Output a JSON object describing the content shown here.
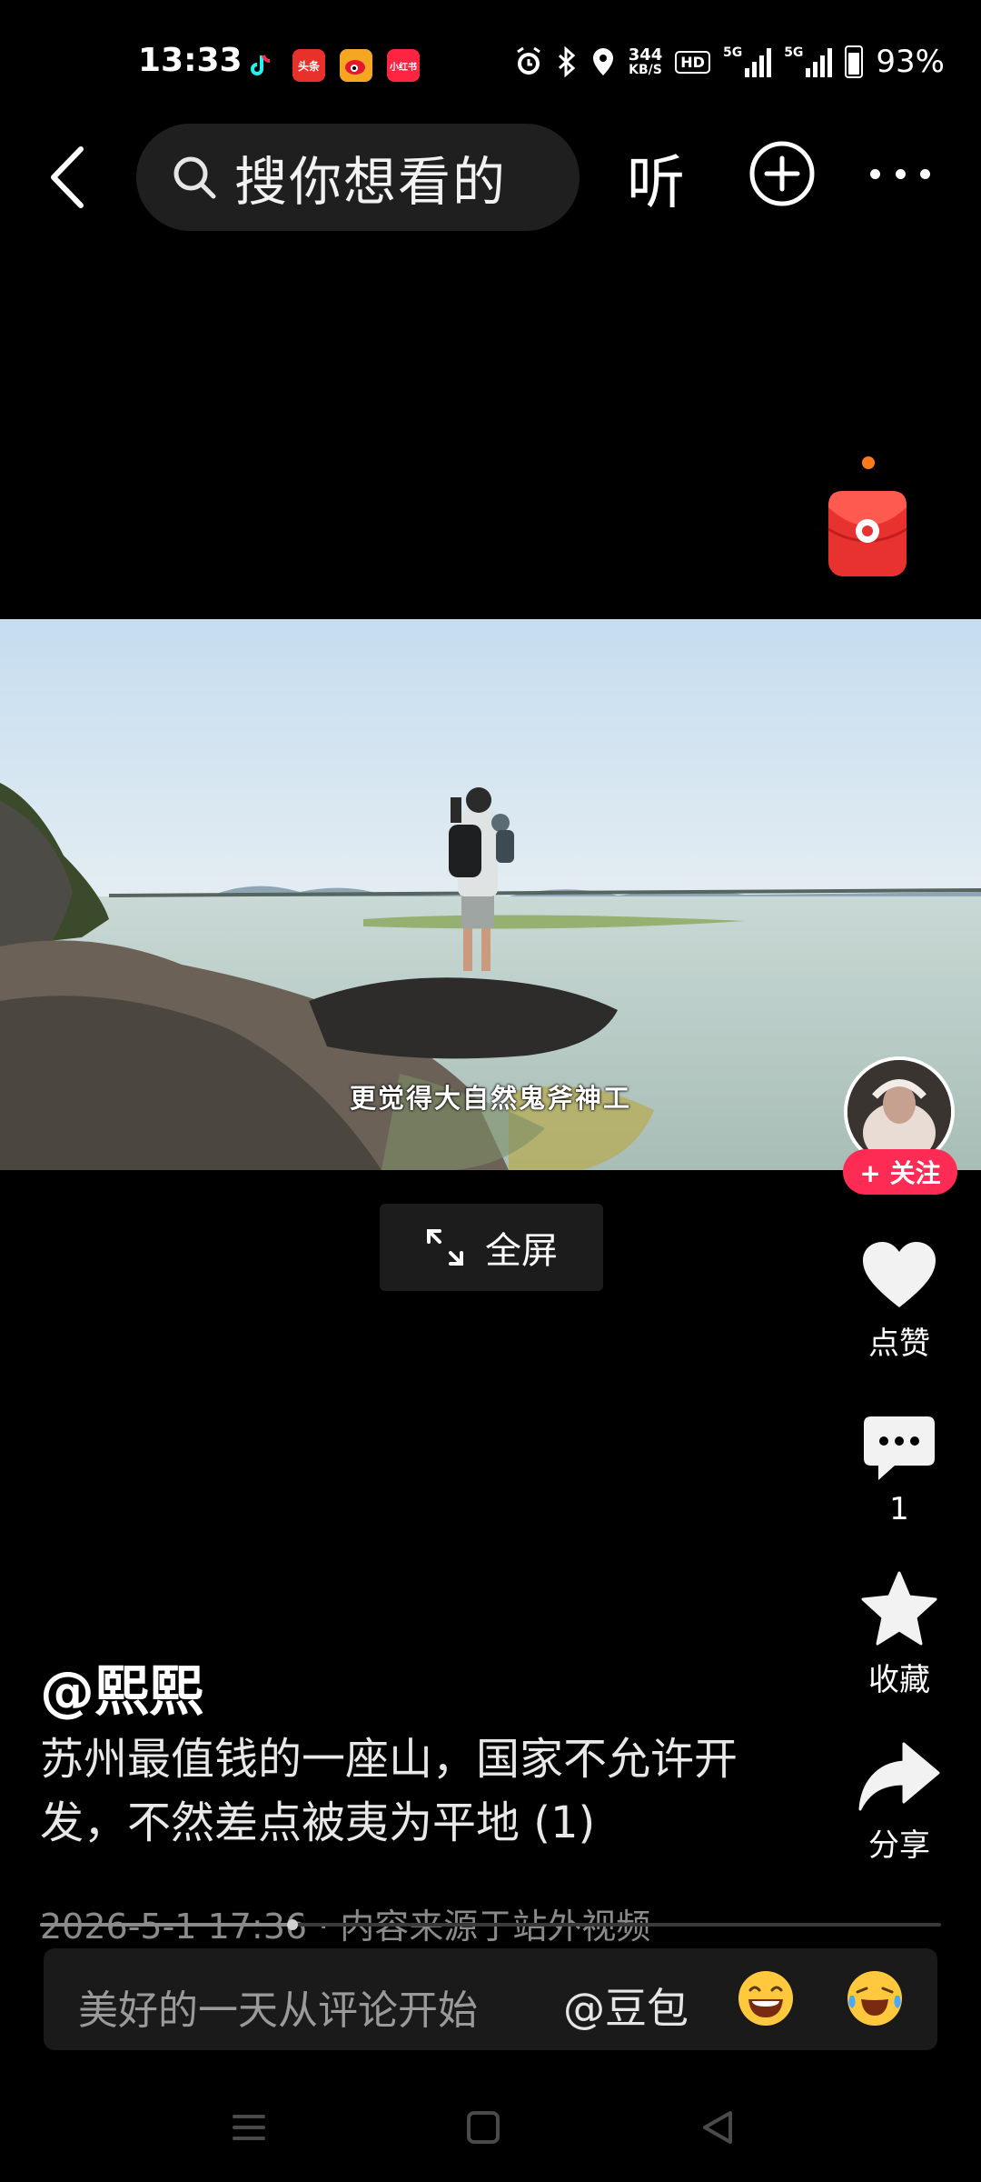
{
  "status_bar": {
    "time": "13:33",
    "apps": [
      {
        "name": "tiktok-icon",
        "label": "",
        "color": "#000000"
      },
      {
        "name": "toutiao-icon",
        "label": "头条",
        "color": "#e8312b"
      },
      {
        "name": "weibo-icon",
        "label": "",
        "color": "#f5a623"
      },
      {
        "name": "xiaohongshu-icon",
        "label": "小红书",
        "color": "#ff2442"
      }
    ],
    "net_speed_value": "344",
    "net_speed_unit": "KB/S",
    "hd_label": "HD",
    "network_1": "5G",
    "network_2": "5G",
    "battery": "93%"
  },
  "top_bar": {
    "search_placeholder": "搜你想看的",
    "listen_label": "听"
  },
  "video": {
    "subtitle": "更觉得大自然鬼斧神工",
    "fullscreen_label": "全屏"
  },
  "rail": {
    "follow_label": "+ 关注",
    "like_label": "点赞",
    "comment_count": "1",
    "favorite_label": "收藏",
    "share_label": "分享"
  },
  "post": {
    "author": "@熙熙",
    "description": "苏州最值钱的一座山，国家不允许开发，不然差点被夷为平地 (1)",
    "meta": "2026-5-1 17:36 · 内容来源于站外视频",
    "progress": 0.28
  },
  "comment_bar": {
    "placeholder": "美好的一天从评论开始",
    "mention": "@豆包"
  },
  "colors": {
    "accent_red": "#fe2c55",
    "envelope_red": "#e8322f",
    "background": "#000000"
  }
}
